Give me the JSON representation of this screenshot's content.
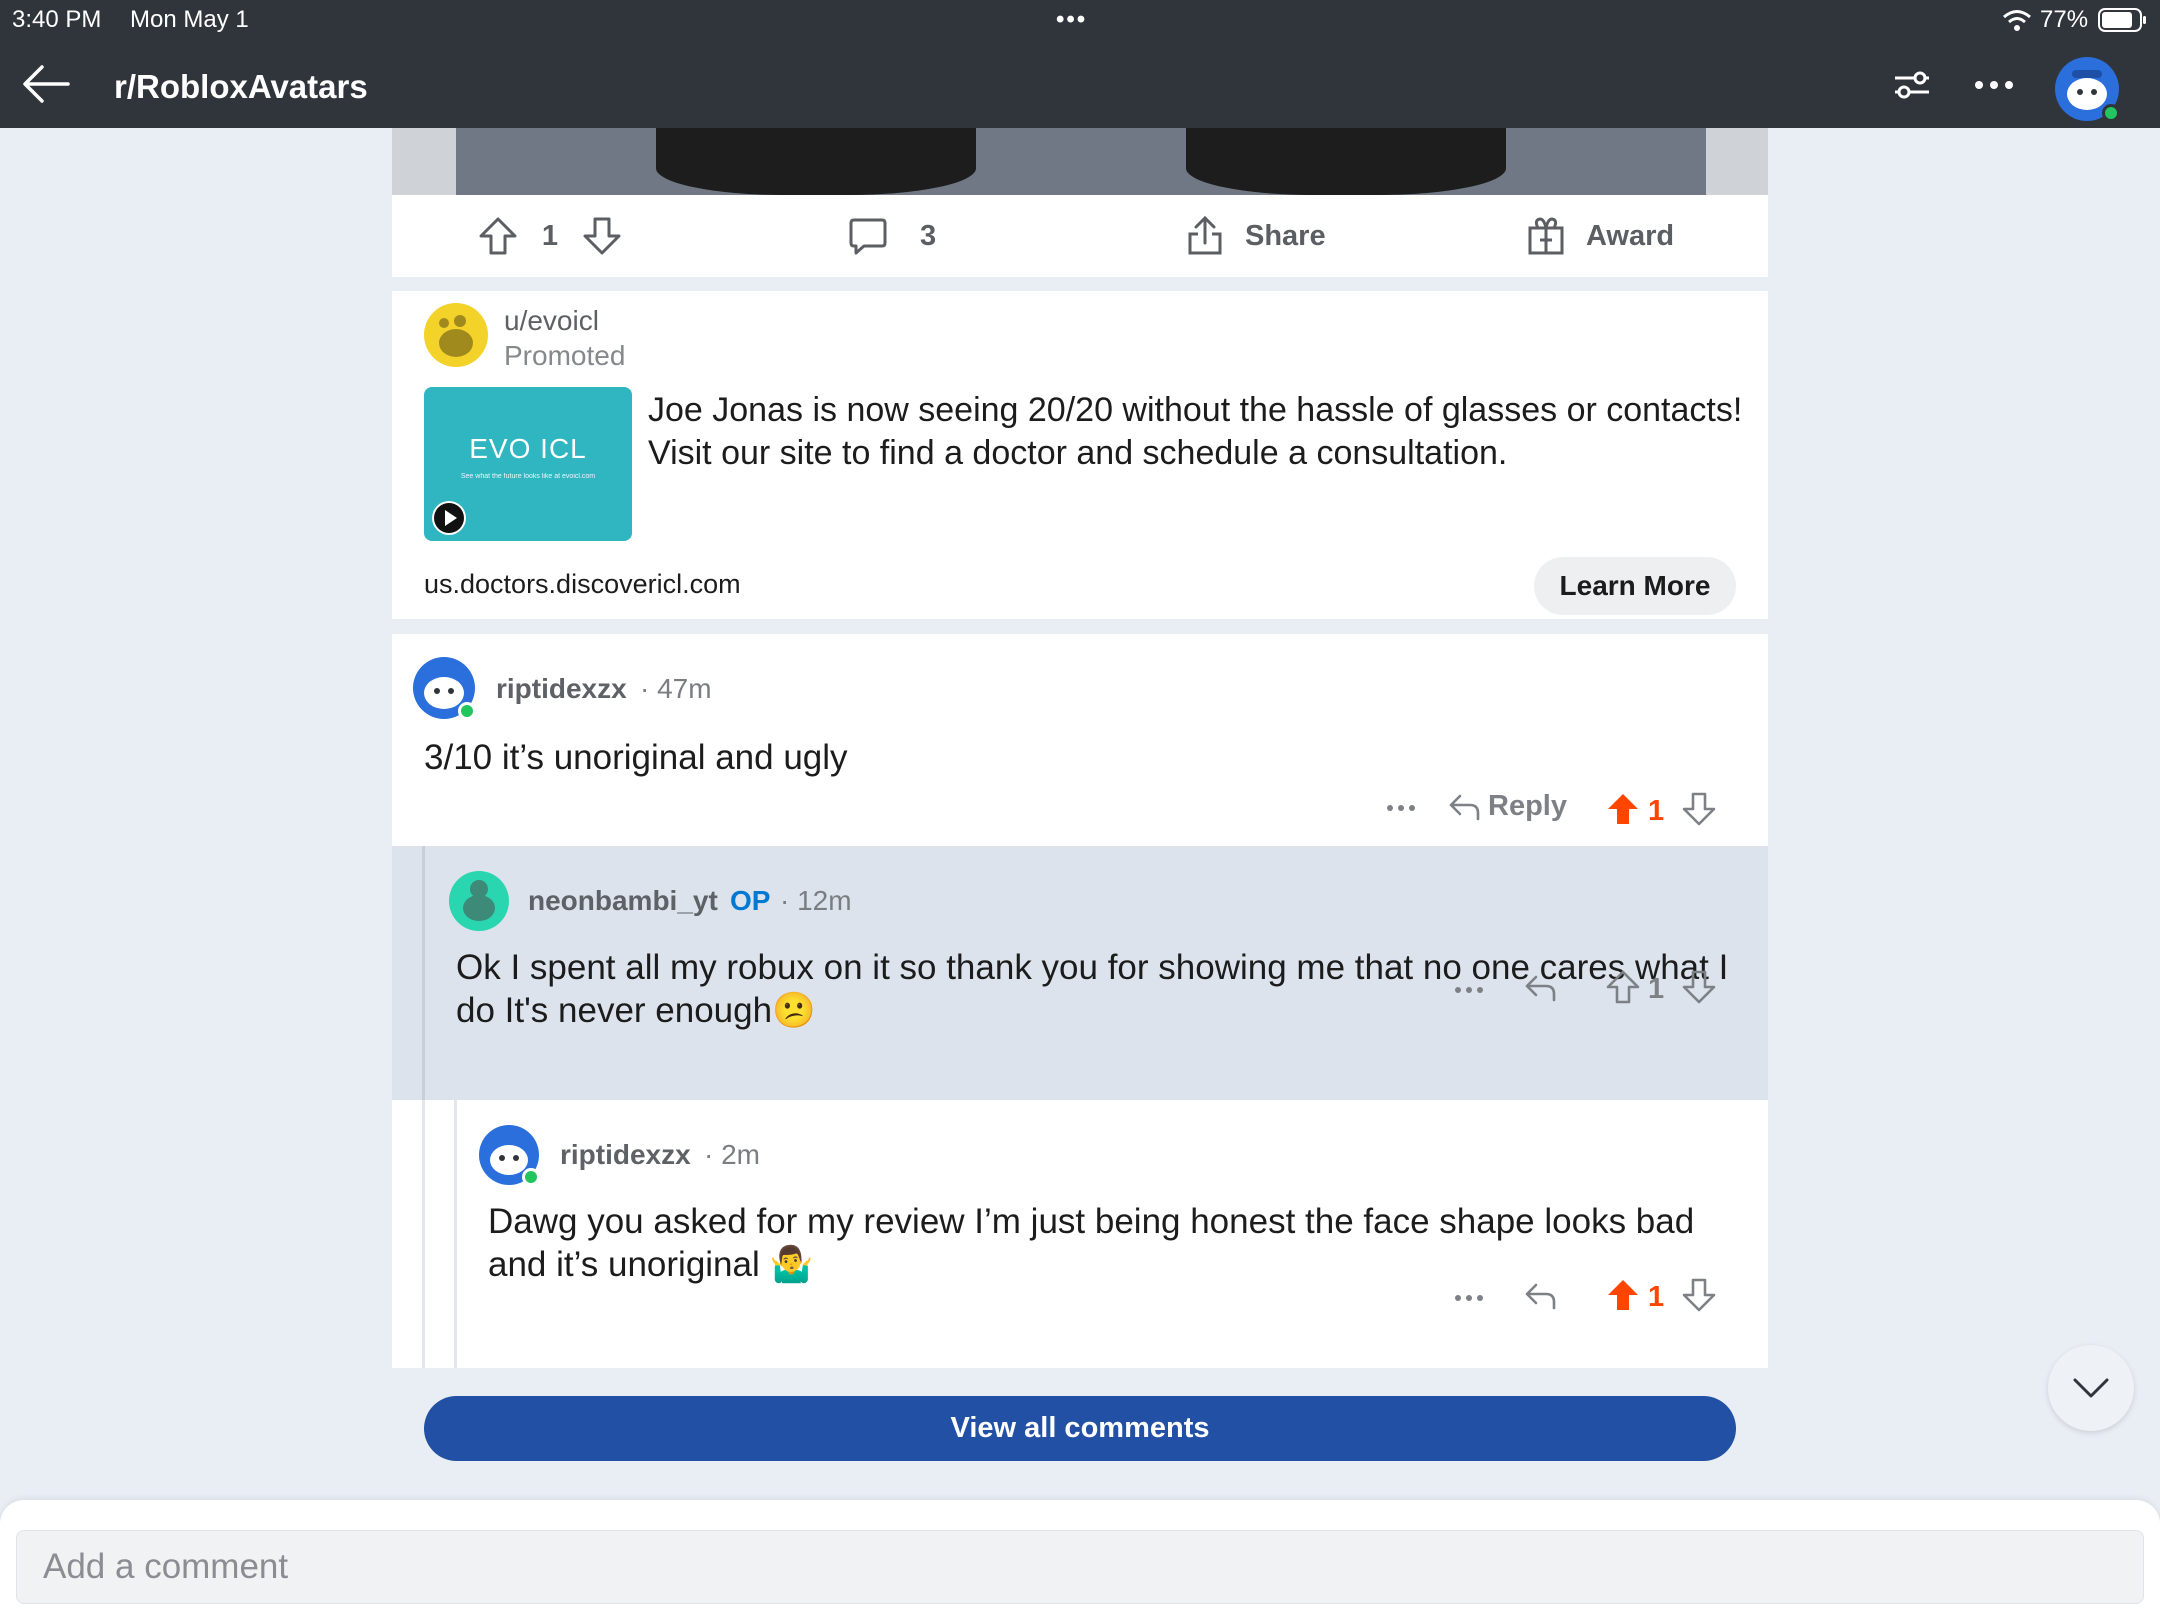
{
  "status_bar": {
    "time": "3:40 PM",
    "date": "Mon May 1",
    "multitask_dots": "•••",
    "battery": "77%"
  },
  "header": {
    "subreddit": "r/RobloxAvatars"
  },
  "post_actions": {
    "votes": "1",
    "comments": "3",
    "share_label": "Share",
    "award_label": "Award"
  },
  "ad": {
    "username": "u/evoicl",
    "promoted_label": "Promoted",
    "thumb_logo": "EVO ICL",
    "thumb_tagline": "See what the future looks like at evoicl.com",
    "text": "Joe Jonas is now seeing 20/20 without the hassle of glasses or contacts! Visit our site to find a doctor and schedule a consultation.",
    "domain": "us.doctors.discovericl.com",
    "cta_label": "Learn More"
  },
  "comments": [
    {
      "username": "riptidexzx",
      "op_badge": "",
      "time": "47m",
      "text": "3/10 it’s unoriginal and ugly",
      "reply_label": "Reply",
      "votes": "1",
      "upvoted": true
    },
    {
      "username": "neonbambi_yt",
      "op_badge": "OP",
      "time": "12m",
      "text": "Ok I spent all my robux on it so thank you for showing me that no one cares what I do It's never enough😕",
      "reply_label": "",
      "votes": "1",
      "upvoted": false
    },
    {
      "username": "riptidexzx",
      "op_badge": "",
      "time": "2m",
      "text": "Dawg you asked for my review I’m just being honest the face shape looks bad and it’s unoriginal 🤷‍♂️",
      "reply_label": "",
      "votes": "1",
      "upvoted": true
    }
  ],
  "view_all_label": "View all comments",
  "composer": {
    "placeholder": "Add a comment"
  },
  "colors": {
    "header_bg": "#30343b",
    "upvote": "#ff4500",
    "button_blue": "#2150a4",
    "highlight_bg": "#dde3ed"
  },
  "icons": [
    "back-arrow-icon",
    "filter-icon",
    "more-icon",
    "avatar-icon",
    "upvote-icon",
    "downvote-icon",
    "comment-icon",
    "share-icon",
    "award-icon",
    "play-icon",
    "reply-icon",
    "chevron-down-icon"
  ]
}
